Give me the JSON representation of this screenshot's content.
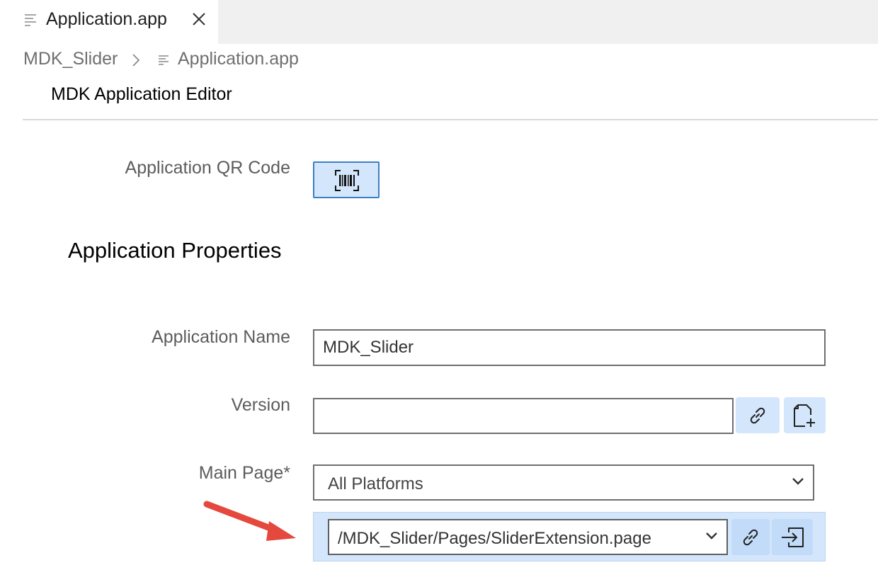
{
  "tab": {
    "label": "Application.app",
    "icon": "file-lines-icon",
    "close_icon": "close-icon"
  },
  "breadcrumb": {
    "root": "MDK_Slider",
    "separator_icon": "chevron-right-icon",
    "file": "Application.app"
  },
  "editor": {
    "title": "MDK Application Editor"
  },
  "qr": {
    "label": "Application QR Code",
    "button_icon": "barcode-icon"
  },
  "properties": {
    "section_title": "Application Properties",
    "application_name": {
      "label": "Application Name",
      "value": "MDK_Slider"
    },
    "version": {
      "label": "Version",
      "value": "",
      "link_icon": "link-icon",
      "new_file_icon": "new-file-icon"
    },
    "main_page": {
      "label": "Main Page*",
      "platform": "All Platforms",
      "page": "/MDK_Slider/Pages/SliderExtension.page",
      "link_icon": "link-icon",
      "open_icon": "open-in-icon"
    }
  },
  "colors": {
    "accent_bg": "#d3e6fb",
    "accent_border": "#3b7fc4",
    "annotation": "#e5483d"
  }
}
